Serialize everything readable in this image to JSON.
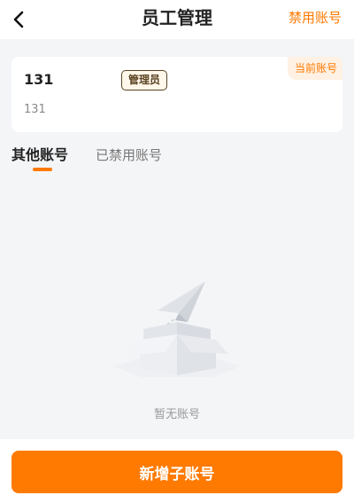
{
  "header": {
    "title": "员工管理",
    "right_action": "禁用账号"
  },
  "current_account": {
    "name": "131",
    "role": "管理员",
    "subtitle": "131",
    "tag": "当前账号"
  },
  "tabs": [
    {
      "label": "其他账号",
      "active": true
    },
    {
      "label": "已禁用账号",
      "active": false
    }
  ],
  "empty_state": {
    "text": "暂无账号",
    "illustration": "empty-box-with-paper-plane"
  },
  "bottom": {
    "add_button_label": "新增子账号"
  },
  "colors": {
    "accent": "#ff7a00",
    "background": "#f4f5f7",
    "card": "#ffffff",
    "badge_border": "#5a4322"
  },
  "icons": {
    "back": "chevron-left-icon"
  }
}
